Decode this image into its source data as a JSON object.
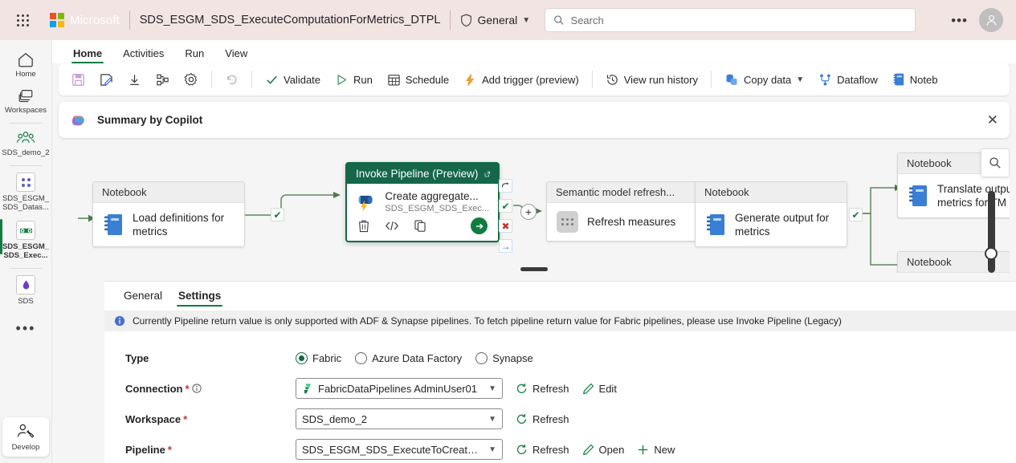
{
  "header": {
    "brand": "Microsoft",
    "doc_title": "SDS_ESGM_SDS_ExecuteComputationForMetrics_DTPL",
    "workspace": "General",
    "search_placeholder": "Search",
    "search_value": "",
    "more_label": "•••",
    "accent_bg": "#f3e4e4"
  },
  "rail": {
    "items": [
      {
        "label": "Home",
        "icon": "home-icon"
      },
      {
        "label": "Workspaces",
        "icon": "workspaces-icon"
      },
      {
        "label": "SDS_demo_2",
        "icon": "people-icon"
      },
      {
        "label": "SDS_ESGM_SDS_Datas...",
        "icon": "lakehouse-icon"
      },
      {
        "label": "SDS_ESGM_SDS_Exec...",
        "icon": "pipeline-icon"
      },
      {
        "label": "SDS",
        "icon": "semantic-model-icon"
      }
    ],
    "more": "•••",
    "develop": "Develop"
  },
  "ribbon": {
    "tabs": [
      "Home",
      "Activities",
      "Run",
      "View"
    ],
    "active_tab": "Home",
    "icon_buttons": [
      {
        "name": "save-button",
        "icon": "save-icon"
      },
      {
        "name": "save-as-button",
        "icon": "save-as-icon"
      },
      {
        "name": "download-button",
        "icon": "download-icon"
      },
      {
        "name": "share-button",
        "icon": "share-icon"
      },
      {
        "name": "settings-button",
        "icon": "gear-icon"
      }
    ],
    "undo": {
      "label": "",
      "icon": "undo-icon"
    },
    "buttons": [
      {
        "label": "Validate",
        "icon": "check-icon"
      },
      {
        "label": "Run",
        "icon": "play-icon"
      },
      {
        "label": "Schedule",
        "icon": "calendar-icon"
      },
      {
        "label": "Add trigger (preview)",
        "icon": "lightning-icon"
      },
      {
        "label": "View run history",
        "icon": "history-icon"
      },
      {
        "label": "Copy data",
        "icon": "copy-data-icon",
        "has_chevron": true
      },
      {
        "label": "Dataflow",
        "icon": "dataflow-icon"
      },
      {
        "label": "Noteb",
        "icon": "notebook-icon"
      }
    ]
  },
  "copilot": {
    "title": "Summary by Copilot",
    "icon": "copilot-icon",
    "close": "✕"
  },
  "canvas": {
    "nodes": [
      {
        "type_label": "Notebook",
        "name": "Load definitions for metrics",
        "icon": "notebook-icon"
      },
      {
        "type_label": "Invoke Pipeline (Preview)",
        "name": "Create aggregate...",
        "subtitle": "SDS_ESGM_SDS_Exec...",
        "icon": "invoke-pipeline-icon",
        "selected": true,
        "actions": [
          "delete-icon",
          "code-icon",
          "clone-icon",
          "run-icon"
        ],
        "external_link": "↗"
      },
      {
        "type_label": "Semantic model refresh...",
        "name": "Refresh measures",
        "icon": "semantic-model-icon"
      },
      {
        "type_label": "Notebook",
        "name": "Generate output for metrics",
        "icon": "notebook-icon"
      },
      {
        "type_label": "Notebook",
        "name": "Translate output metrics for TM",
        "icon": "notebook-icon"
      },
      {
        "type_label": "Notebook",
        "name": "",
        "icon": "notebook-icon"
      }
    ],
    "badges": [
      {
        "name": "on-skip-badge",
        "glyph": "↷",
        "color": "#4a4a4a"
      },
      {
        "name": "on-success-badge",
        "glyph": "✔",
        "color": "#107c41"
      },
      {
        "name": "on-fail-badge",
        "glyph": "✖",
        "color": "#c4342b"
      },
      {
        "name": "on-completion-badge",
        "glyph": "→",
        "color": "#2b6cb8"
      }
    ],
    "add_activity": "+",
    "zoom_icon": "search-icon"
  },
  "panel": {
    "tabs": [
      "General",
      "Settings"
    ],
    "active_tab": "Settings",
    "collapse_icon": "∧",
    "info": {
      "icon": "info-icon",
      "text": "Currently Pipeline return value is only supported with ADF & Synapse pipelines. To fetch pipeline return value for Fabric pipelines, please use Invoke Pipeline (Legacy)",
      "close": "✕"
    },
    "fields": [
      {
        "label": "Type",
        "required": false,
        "control": "radio",
        "options": [
          "Fabric",
          "Azure Data Factory",
          "Synapse"
        ],
        "selected": "Fabric"
      },
      {
        "label": "Connection",
        "required": true,
        "info_icon": "info-circle-icon",
        "control": "dropdown",
        "value": "FabricDataPipelines AdminUser01",
        "value_icon": "fabric-connection-icon",
        "actions": [
          {
            "label": "Refresh",
            "icon": "refresh-icon"
          },
          {
            "label": "Edit",
            "icon": "pencil-icon"
          }
        ]
      },
      {
        "label": "Workspace",
        "required": true,
        "control": "dropdown",
        "value": "SDS_demo_2",
        "actions": [
          {
            "label": "Refresh",
            "icon": "refresh-icon"
          }
        ]
      },
      {
        "label": "Pipeline",
        "required": true,
        "control": "dropdown",
        "value": "SDS_ESGM_SDS_ExecuteToCreateAg...",
        "actions": [
          {
            "label": "Refresh",
            "icon": "refresh-icon"
          },
          {
            "label": "Open",
            "icon": "pencil-icon"
          },
          {
            "label": "New",
            "icon": "plus-icon"
          }
        ]
      }
    ]
  }
}
